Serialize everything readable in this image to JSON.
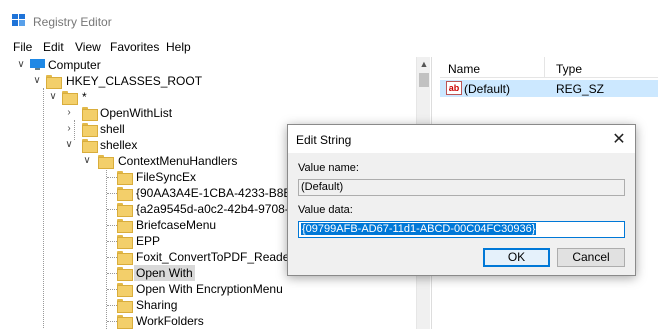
{
  "window": {
    "title": "Registry Editor"
  },
  "menu": [
    "File",
    "Edit",
    "View",
    "Favorites",
    "Help"
  ],
  "tree": {
    "computer": "Computer",
    "hive": "HKEY_CLASSES_ROOT",
    "star": "*",
    "openwithlist": "OpenWithList",
    "shell": "shell",
    "shellex": "shellex",
    "contextmenuhandlers": "ContextMenuHandlers",
    "items": [
      "FileSyncEx",
      "{90AA3A4E-1CBA-4233-B8BB-53",
      "{a2a9545d-a0c2-42b4-9708-a0b",
      "BriefcaseMenu",
      "EPP",
      "Foxit_ConvertToPDF_Reader",
      "Open With",
      "Open With EncryptionMenu",
      "Sharing",
      "WorkFolders"
    ]
  },
  "list": {
    "headers": {
      "name": "Name",
      "type": "Type"
    },
    "rows": [
      {
        "name": "(Default)",
        "type": "REG_SZ"
      }
    ]
  },
  "dialog": {
    "title": "Edit String",
    "value_name_label": "Value name:",
    "value_name": "(Default)",
    "value_data_label": "Value data:",
    "value_data": "{09799AFB-AD67-11d1-ABCD-00C04FC30936}",
    "ok": "OK",
    "cancel": "Cancel"
  }
}
